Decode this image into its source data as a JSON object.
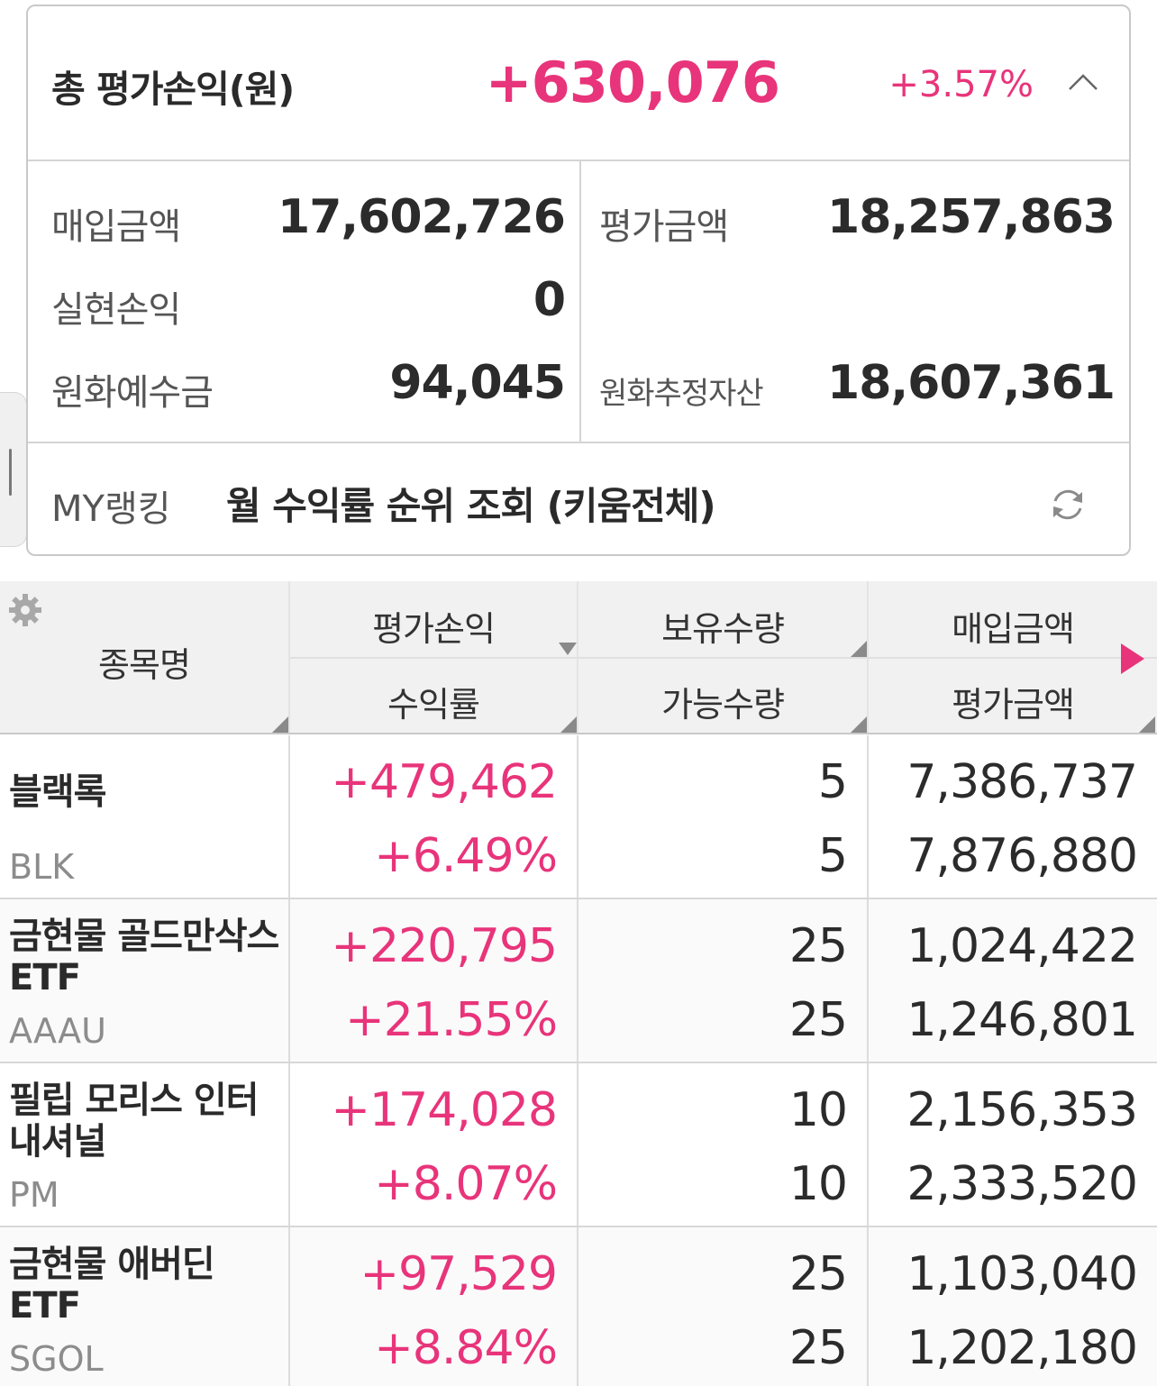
{
  "summary": {
    "title": "총 평가손익(원)",
    "total_pl": "+630,076",
    "total_rate": "+3.57%",
    "buy_label": "매입금액",
    "buy_value": "17,602,726",
    "eval_label": "평가금액",
    "eval_value": "18,257,863",
    "realized_label": "실현손익",
    "realized_value": "0",
    "deposit_label": "원화예수금",
    "deposit_value": "94,045",
    "est_asset_label": "원화추정자산",
    "est_asset_value": "18,607,361"
  },
  "ranking": {
    "label": "MY랭킹",
    "text": "월 수익률 순위 조회 (키움전체)"
  },
  "table": {
    "headers": {
      "name": "종목명",
      "pl": "평가손익",
      "rate": "수익률",
      "qty": "보유수량",
      "avail": "가능수량",
      "buy": "매입금액",
      "eval": "평가금액"
    },
    "rows": [
      {
        "name": "블랙록",
        "ticker": "BLK",
        "pl": "+479,462",
        "rate": "+6.49%",
        "qty": "5",
        "avail": "5",
        "buy": "7,386,737",
        "eval": "7,876,880"
      },
      {
        "name": "금현물 골드만삭스 ETF",
        "ticker": "AAAU",
        "pl": "+220,795",
        "rate": "+21.55%",
        "qty": "25",
        "avail": "25",
        "buy": "1,024,422",
        "eval": "1,246,801"
      },
      {
        "name": "필립 모리스 인터내셔널",
        "ticker": "PM",
        "pl": "+174,028",
        "rate": "+8.07%",
        "qty": "10",
        "avail": "10",
        "buy": "2,156,353",
        "eval": "2,333,520"
      },
      {
        "name": "금현물 애버딘 ETF",
        "ticker": "SGOL",
        "pl": "+97,529",
        "rate": "+8.84%",
        "qty": "25",
        "avail": "25",
        "buy": "1,103,040",
        "eval": "1,202,180"
      }
    ]
  },
  "icons": {
    "collapse": "chevron-up-icon",
    "refresh": "refresh-icon",
    "settings": "gear-icon",
    "next_columns": "play-right-icon"
  },
  "colors": {
    "accent": "#e8347a",
    "text": "#2b2b2b",
    "label": "#555555",
    "ticker": "#8c8c8c"
  }
}
